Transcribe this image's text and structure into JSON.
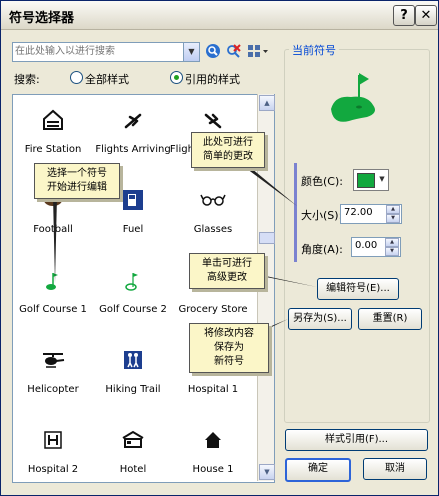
{
  "window": {
    "title": "符号选择器"
  },
  "search": {
    "placeholder": "在此处输入以进行搜索",
    "label": "搜索:",
    "options": [
      "全部样式",
      "引用的样式"
    ],
    "selected": "引用的样式"
  },
  "symbols": [
    {
      "name": "Fire Station",
      "icon": "fire-station-icon"
    },
    {
      "name": "Flights Arriving",
      "icon": "airplane-icon"
    },
    {
      "name": "Flights Departing",
      "icon": "airplane-icon"
    },
    {
      "name": "Football",
      "icon": "football-icon"
    },
    {
      "name": "Fuel",
      "icon": "fuel-pump-icon"
    },
    {
      "name": "Glasses",
      "icon": "glasses-icon"
    },
    {
      "name": "Golf Course 1",
      "icon": "golf-flag-icon"
    },
    {
      "name": "Golf Course 2",
      "icon": "golf-flag-icon"
    },
    {
      "name": "Grocery Store",
      "icon": "shopping-cart-icon"
    },
    {
      "name": "Helicopter",
      "icon": "helicopter-icon"
    },
    {
      "name": "Hiking Trail",
      "icon": "hikers-icon"
    },
    {
      "name": "Hospital 1",
      "icon": "hospital-icon"
    },
    {
      "name": "Hospital 2",
      "icon": "hospital-icon"
    },
    {
      "name": "Hotel",
      "icon": "hotel-bed-icon"
    },
    {
      "name": "House 1",
      "icon": "house-icon"
    }
  ],
  "current_symbol": {
    "group_title": "当前符号",
    "color_label": "颜色(C):",
    "color_value": "#12a83f",
    "size_label": "大小(S):",
    "size_value": "72.00",
    "angle_label": "角度(A):",
    "angle_value": "0.00"
  },
  "buttons": {
    "edit_symbol": "编辑符号(E)...",
    "save_as": "另存为(S)...",
    "reset": "重置(R)",
    "style_references": "样式引用(F)...",
    "ok": "确定",
    "cancel": "取消"
  },
  "callouts": {
    "select_symbol": [
      "选择一个符号",
      "开始进行编辑"
    ],
    "simple_changes": [
      "此处可进行",
      "简单的更改"
    ],
    "advanced_changes": [
      "单击可进行",
      "高级更改"
    ],
    "save_new": [
      "将修改内容",
      "保存为",
      "新符号"
    ]
  }
}
